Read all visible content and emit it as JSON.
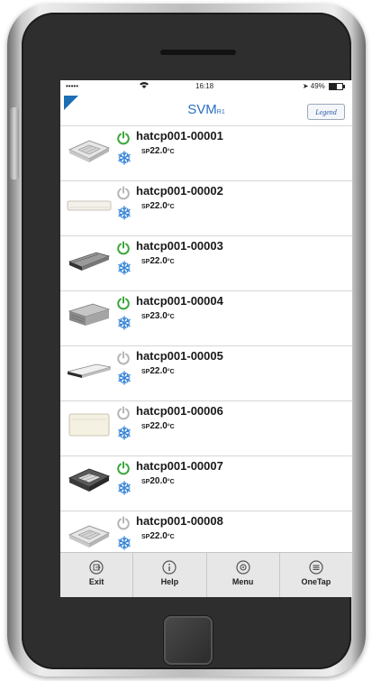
{
  "status_bar": {
    "signal": "•••••",
    "time": "16:18",
    "battery": "49%"
  },
  "header": {
    "title": "SVM",
    "title_suffix": "R1",
    "legend_label": "Legend"
  },
  "units": [
    {
      "name": "hatcp001-00001",
      "sp_prefix": "SP",
      "setpoint": "22.0",
      "unit_symbol": "°C",
      "power": "on",
      "type": "cassette"
    },
    {
      "name": "hatcp001-00002",
      "sp_prefix": "SP",
      "setpoint": "22.0",
      "unit_symbol": "°C",
      "power": "off",
      "type": "wall"
    },
    {
      "name": "hatcp001-00003",
      "sp_prefix": "SP",
      "setpoint": "22.0",
      "unit_symbol": "°C",
      "power": "on",
      "type": "duct"
    },
    {
      "name": "hatcp001-00004",
      "sp_prefix": "SP",
      "setpoint": "23.0",
      "unit_symbol": "°C",
      "power": "on",
      "type": "ducted-box"
    },
    {
      "name": "hatcp001-00005",
      "sp_prefix": "SP",
      "setpoint": "22.0",
      "unit_symbol": "°C",
      "power": "off",
      "type": "ceiling"
    },
    {
      "name": "hatcp001-00006",
      "sp_prefix": "SP",
      "setpoint": "22.0",
      "unit_symbol": "°C",
      "power": "off",
      "type": "floor"
    },
    {
      "name": "hatcp001-00007",
      "sp_prefix": "SP",
      "setpoint": "20.0",
      "unit_symbol": "°C",
      "power": "on",
      "type": "cassette-dark"
    },
    {
      "name": "hatcp001-00008",
      "sp_prefix": "SP",
      "setpoint": "22.0",
      "unit_symbol": "°C",
      "power": "off",
      "type": "cassette"
    }
  ],
  "tabs": [
    {
      "label": "Exit",
      "icon": "exit-icon"
    },
    {
      "label": "Help",
      "icon": "info-icon"
    },
    {
      "label": "Menu",
      "icon": "menu-gear-icon"
    },
    {
      "label": "OneTap",
      "icon": "list-icon"
    }
  ],
  "colors": {
    "accent": "#2a6fc2",
    "power_on": "#3aa63a",
    "power_off": "#b5b5b5",
    "cool": "#3a86d8"
  }
}
